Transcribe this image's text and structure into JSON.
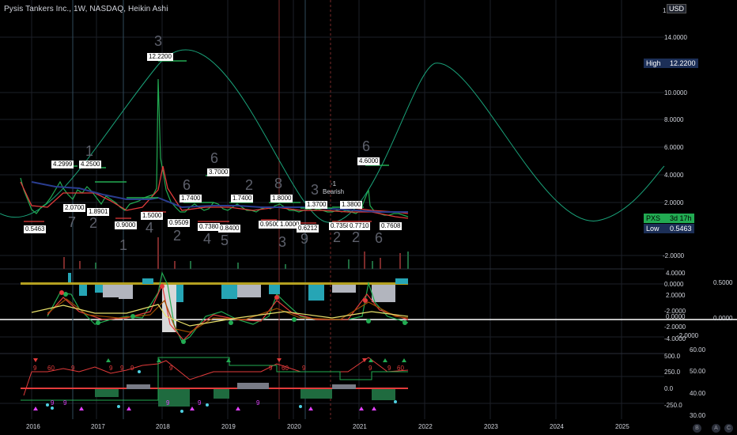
{
  "header": {
    "title": "Pysis Tankers Inc., 1W, NASDAQ, Heikin Ashi",
    "currency": "USD"
  },
  "price_axis": {
    "labels": [
      "14.0000",
      "10.0000",
      "8.0000",
      "6.0000",
      "4.0000",
      "2.0000",
      "-2.0000"
    ],
    "top_label": "1"
  },
  "osc_axis_left": {
    "labels": [
      "4.0000",
      "2.0000",
      "0.0000",
      "-2.0000",
      "-4.0000"
    ]
  },
  "osc_axis_mid": {
    "labels": [
      "0.0000",
      "-2.0000"
    ]
  },
  "osc_axis_right": {
    "labels": [
      "0.5000",
      "0.0000"
    ]
  },
  "osc2_axis_left": {
    "labels": [
      "500.0",
      "250.0",
      "0.0",
      "-250.0"
    ]
  },
  "osc2_axis_right": {
    "labels": [
      "60.00",
      "50.00",
      "40.00",
      "30.00"
    ]
  },
  "badges": {
    "high_label": "High",
    "high_value": "12.2200",
    "low_label": "Low",
    "low_value": "0.5463",
    "ticker": "PXS",
    "ticker_time": "3d 17h"
  },
  "time_axis": {
    "labels": [
      "2016",
      "2017",
      "2018",
      "2019",
      "2020",
      "2021",
      "2022",
      "2023",
      "2024",
      "2025"
    ]
  },
  "price_boxes": [
    "4.2999",
    "4.2500",
    "12.2200",
    "3.7000",
    "4.6000",
    "1.7400",
    "1.7400",
    "1.8000",
    "1.3700",
    "1.3800",
    "0.5463",
    "2.0700",
    "1.8901",
    "0.9000",
    "1.5000",
    "0.9509",
    "0.7380",
    "0.8400",
    "0.9500",
    "1.0000",
    "0.6212",
    "0.7358",
    "0.7710",
    "0.7608"
  ],
  "big_numbers": [
    "3",
    "1",
    "6",
    "6",
    "2",
    "8",
    "3",
    "6",
    "7",
    "2",
    "1",
    "4",
    "2",
    "4",
    "5",
    "3",
    "9",
    "2",
    "2",
    "6"
  ],
  "annotations": {
    "bearish_value": "-1",
    "bearish_label": "Bearish"
  },
  "osc_markers": [
    "9",
    "60",
    "9",
    "9",
    "9",
    "9",
    "9",
    "9",
    "60",
    "9",
    "9",
    "9",
    "9",
    "9",
    "9",
    "9",
    "60",
    "9"
  ],
  "bottom_icons": [
    "B",
    "A",
    "C"
  ],
  "colors": {
    "background": "#000000",
    "up": "#22ab52",
    "down": "#e23b3b",
    "cycle": "#1aa37a",
    "badge": "#1c2f57",
    "accent_yellow": "#f5c518"
  }
}
